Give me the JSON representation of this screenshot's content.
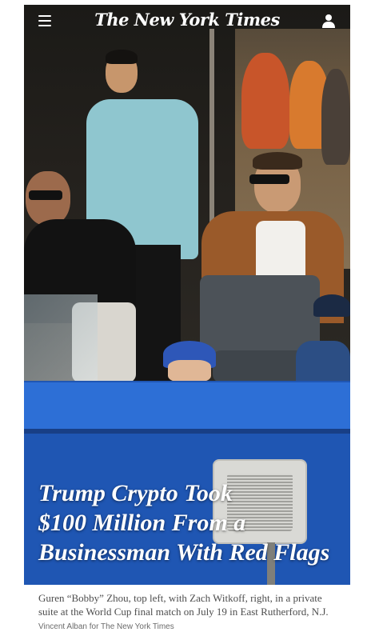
{
  "header": {
    "masthead": "The New York Times",
    "menu_icon": "hamburger-menu-icon",
    "account_icon": "user-account-icon"
  },
  "article": {
    "headline_line1": "Trump Crypto Took",
    "headline_line2": "$100 Million From a",
    "headline_line3": "Businessman With Red Flags",
    "caption": "Guren “Bobby” Zhou, top left, with Zach Witkoff, right, in a private suite at the World Cup final match on July 19 in East Rutherford, N.J.",
    "credit": "Vincent Alban for The New York Times"
  },
  "colors": {
    "stadium_blue": "#1f56b3",
    "header_text": "#ffffff",
    "caption_text": "#4d4d4d"
  }
}
